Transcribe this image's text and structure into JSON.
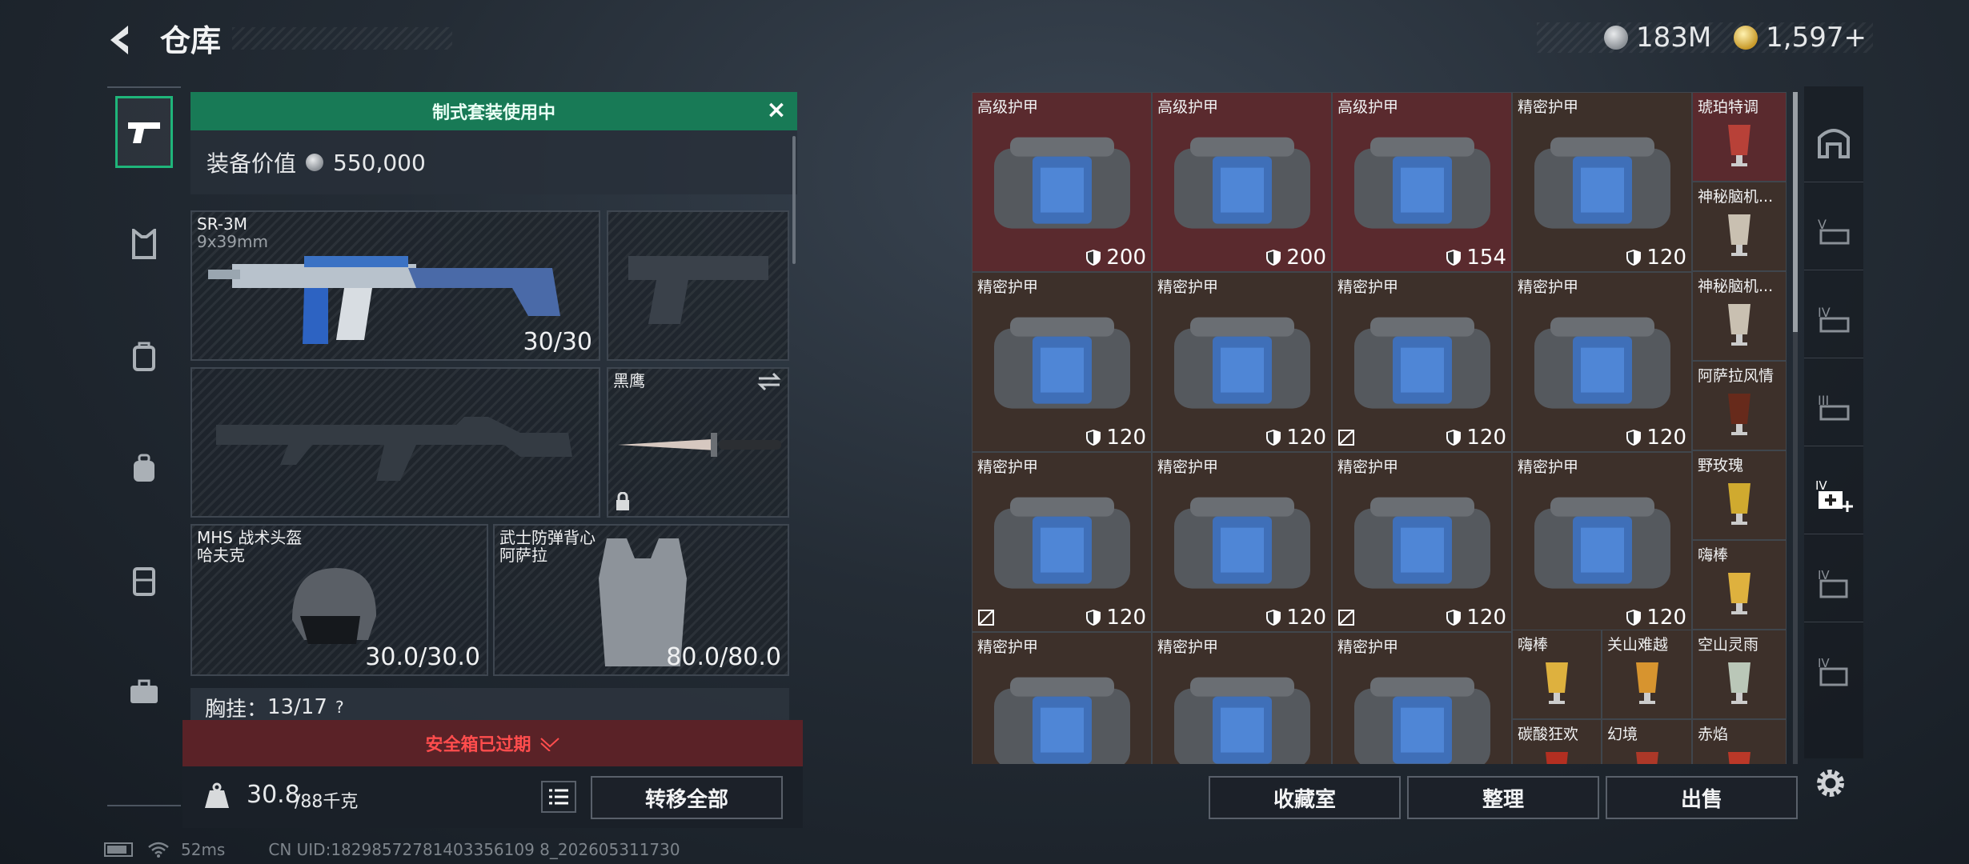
{
  "header": {
    "title": "仓库",
    "currency_silver": "183M",
    "currency_gold": "1,597+"
  },
  "loadout": {
    "banner": "制式套装使用中",
    "value_label": "装备价值",
    "value": "550,000",
    "primary": {
      "name": "SR-3M",
      "caliber": "9x39mm",
      "ammo": "30/30"
    },
    "melee": {
      "name": "黑鹰"
    },
    "helmet": {
      "name": "MHS 战术头盔",
      "sub": "哈夫克",
      "durability": "30.0/30.0"
    },
    "armor": {
      "name": "武士防弹背心",
      "sub": "阿萨拉",
      "durability": "80.0/80.0"
    },
    "chest": "胸挂：",
    "chest_count": "13/17",
    "chest_help": "?",
    "expired": "安全箱已过期",
    "weight": "30.8",
    "weight_max": "/88千克",
    "transfer_all": "转移全部"
  },
  "grid": {
    "items": [
      {
        "label": "高级护甲",
        "dur": "200"
      },
      {
        "label": "高级护甲",
        "dur": "200"
      },
      {
        "label": "高级护甲",
        "dur": "154"
      },
      {
        "label": "精密护甲",
        "dur": "120"
      },
      {
        "label": "精密护甲",
        "dur": "120"
      },
      {
        "label": "精密护甲",
        "dur": "120"
      },
      {
        "label": "精密护甲",
        "dur": "120"
      },
      {
        "label": "精密护甲",
        "dur": "120"
      },
      {
        "label": "精密护甲",
        "dur": "120"
      },
      {
        "label": "精密护甲",
        "dur": "120"
      },
      {
        "label": "精密护甲",
        "dur": "120"
      },
      {
        "label": "精密护甲",
        "dur": "120"
      },
      {
        "label": "精密护甲",
        "dur": ""
      },
      {
        "label": "精密护甲",
        "dur": ""
      },
      {
        "label": "精密护甲",
        "dur": ""
      }
    ],
    "small": [
      "琥珀特调",
      "神秘脑机...",
      "神秘脑机...",
      "阿萨拉风情",
      "野玫瑰",
      "嗨棒",
      "嗨棒",
      "关山难越",
      "空山灵雨",
      "碳酸狂欢",
      "幻境",
      "赤焰"
    ]
  },
  "actions": {
    "collection": "收藏室",
    "organize": "整理",
    "sell": "出售"
  },
  "status": {
    "ping": "52ms",
    "uid": "CN UID:18298572781403356109 8_202605311730"
  },
  "colors": {
    "accent": "#187a56",
    "expired": "#ff4d4d",
    "red_cell": "#5a2a2e"
  }
}
